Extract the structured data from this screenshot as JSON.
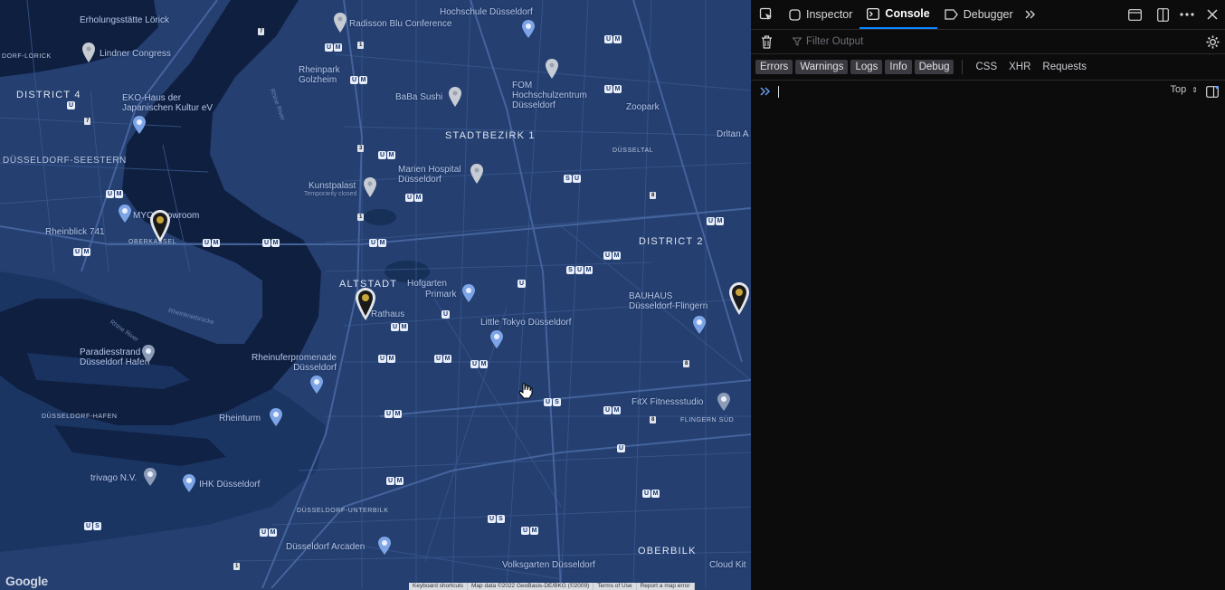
{
  "map": {
    "area_labels": {
      "district4": "DISTRICT 4",
      "stadtbezirk1": "STADTBEZIRK 1",
      "district2": "DISTRICT 2",
      "altstadt": "ALTSTADT",
      "oberbilk": "OBERBILK",
      "seestern": "DÜSSELDORF-SEESTERN",
      "oberkassel": "OBERKASSEL",
      "hafen": "DÜSSELDORF-HAFEN",
      "unterbilk": "DÜSSELDORF-UNTERBILK",
      "duesseltal": "DÜSSELTAL",
      "flingern": "FLINGERN SÜD",
      "lorick": "DORF-LORICK"
    },
    "pois": {
      "erholungsstaette": "Erholungsstätte Lörick",
      "radisson": "Radisson Blu Conference",
      "hochschule": "Hochschule Düsseldorf",
      "lindner": "Lindner Congress",
      "rheinpark": "Rheinpark Golzheim",
      "babasushi": "BaBa Sushi",
      "fom": "FOM Hochschulzentrum Düsseldorf",
      "eko": "EKO-Haus der Japanischen Kultur eV",
      "zoopark": "Zoopark",
      "marien": "Marien Hospital Düsseldorf",
      "kunstpalast": "Kunstpalast",
      "kunstpalast_note": "Temporarily closed",
      "myo": "MYO Showroom",
      "rheinblick": "Rheinblick 741",
      "horgarten": "Hofgarten",
      "primark": "Primark",
      "rathaus": "Rathaus",
      "bauhaus": "BAUHAUS Düsseldorf-Flingern",
      "littletokyo": "Little Tokyo Düsseldorf",
      "paradiesstrand": "Paradiesstrand Düsseldorf Hafen",
      "rheinuferpromenade": "Rheinuferpromenade Düsseldorf",
      "fitx": "FitX Fitnessstudio",
      "rheinturm": "Rheinturm",
      "trivago": "trivago N.V.",
      "ihk": "IHK Düsseldorf",
      "arcaden": "Düsseldorf Arcaden",
      "drltan": "Drltan A",
      "cloudkit": "Cloud Kit",
      "volksgarten": "Volksgarten Düsseldorf"
    },
    "roads": {
      "rhine_river": "Rhine River",
      "rheinkniebruecke": "Rheinkniebrücke",
      "rhine_river2": "Rhine River"
    },
    "google_logo": "Google",
    "attribution": [
      "Keyboard shortcuts",
      "Map data ©2022 GeoBasis-DE/BKG (©2009)",
      "Terms of Use",
      "Report a map error"
    ]
  },
  "devtools": {
    "tabs": [
      {
        "label": "Inspector"
      },
      {
        "label": "Console"
      },
      {
        "label": "Debugger"
      }
    ],
    "active_tab": "Console",
    "filter_placeholder": "Filter Output",
    "level_filters": [
      "Errors",
      "Warnings",
      "Logs",
      "Info",
      "Debug"
    ],
    "type_filters": [
      "CSS",
      "XHR",
      "Requests"
    ],
    "context_selector": "Top",
    "colors": {
      "accent": "#0a84ff",
      "background": "#0c0c0d",
      "map_bg": "#213b6b"
    }
  }
}
